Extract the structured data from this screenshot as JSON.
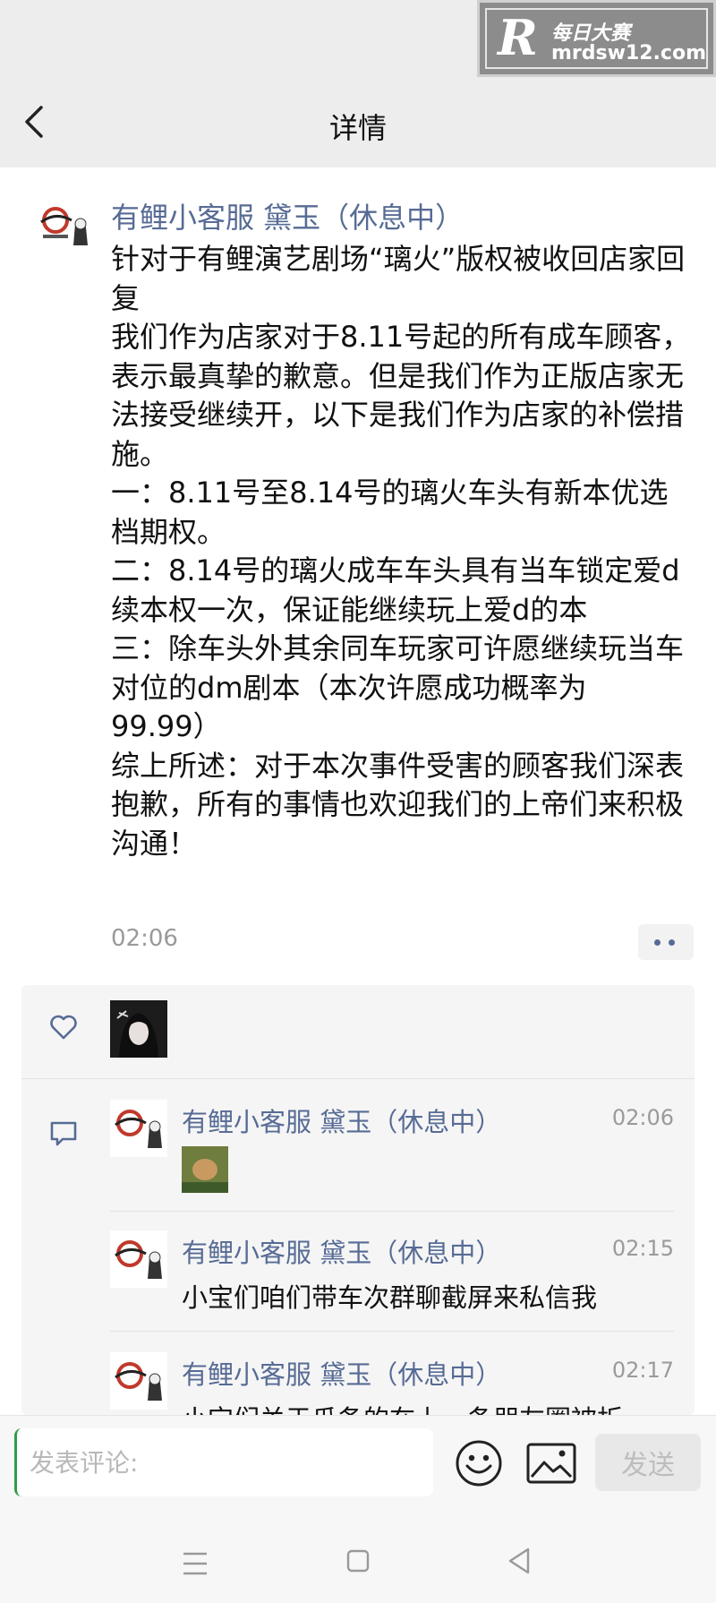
{
  "header": {
    "title": "详情",
    "watermark": {
      "logo": "R",
      "name": "每日大赛",
      "domain": "mrdsw12.com"
    }
  },
  "post": {
    "author": "有鲤小客服 黛玉（休息中）",
    "body": "针对于有鲤演艺剧场“璃火”版权被收回店家回复\n我们作为店家对于8.11号起的所有成车顾客，表示最真挚的歉意。但是我们作为正版店家无法接受继续开，以下是我们作为店家的补偿措施。\n一：8.11号至8.14号的璃火车头有新本优选档期权。\n二：8.14号的璃火成车车头具有当车锁定爱d续本权一次，保证能继续玩上爱d的本\n三：除车头外其余同车玩家可许愿继续玩当车对位的dm剧本（本次许愿成功概率为99.99）\n综上所述：对于本次事件受害的顾客我们深表抱歉，所有的事情也欢迎我们的上帝们来积极沟通！",
    "time": "02:06"
  },
  "comments": [
    {
      "author": "有鲤小客服 黛玉（休息中）",
      "time": "02:06",
      "text": ""
    },
    {
      "author": "有鲤小客服 黛玉（休息中）",
      "time": "02:15",
      "text": "小宝们咱们带车次群聊截屏来私信我"
    },
    {
      "author": "有鲤小客服 黛玉（休息中）",
      "time": "02:17",
      "text": "小宝们关于瓜备的在上一条朋友圈被折"
    }
  ],
  "comment_bar": {
    "placeholder": "发表评论:",
    "send_label": "发送"
  },
  "colors": {
    "link": "#576b95",
    "accent": "#2e9c4a"
  }
}
